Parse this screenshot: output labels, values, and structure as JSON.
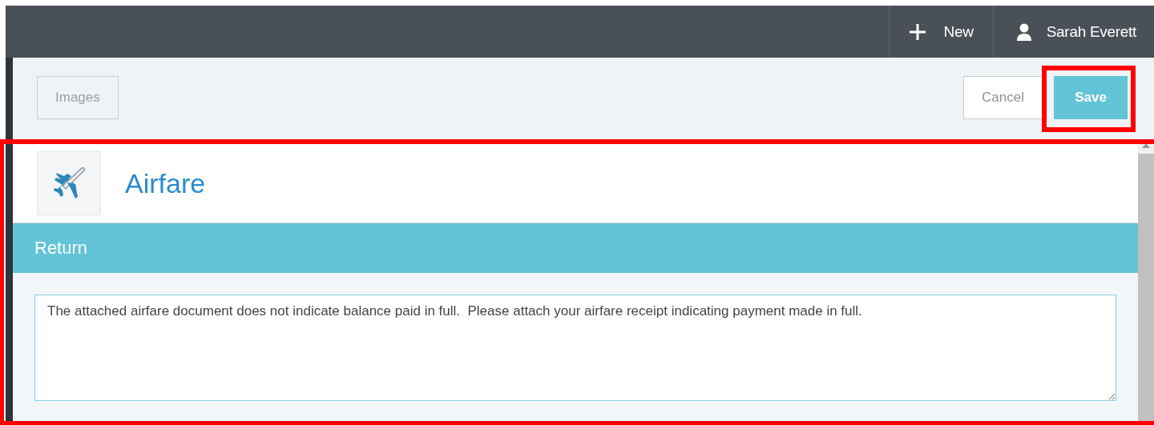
{
  "top_bar": {
    "new_button": "New",
    "user_name": "Sarah Everett"
  },
  "toolbar": {
    "images_button": "Images",
    "cancel_button": "Cancel",
    "save_button": {
      "label": "Save",
      "highlighted": true
    }
  },
  "panel": {
    "highlighted": true,
    "title": "Airfare",
    "section": "Return",
    "comment": "The attached airfare document does not indicate balance paid in full.  Please attach your airfare receipt indicating payment made in full."
  }
}
